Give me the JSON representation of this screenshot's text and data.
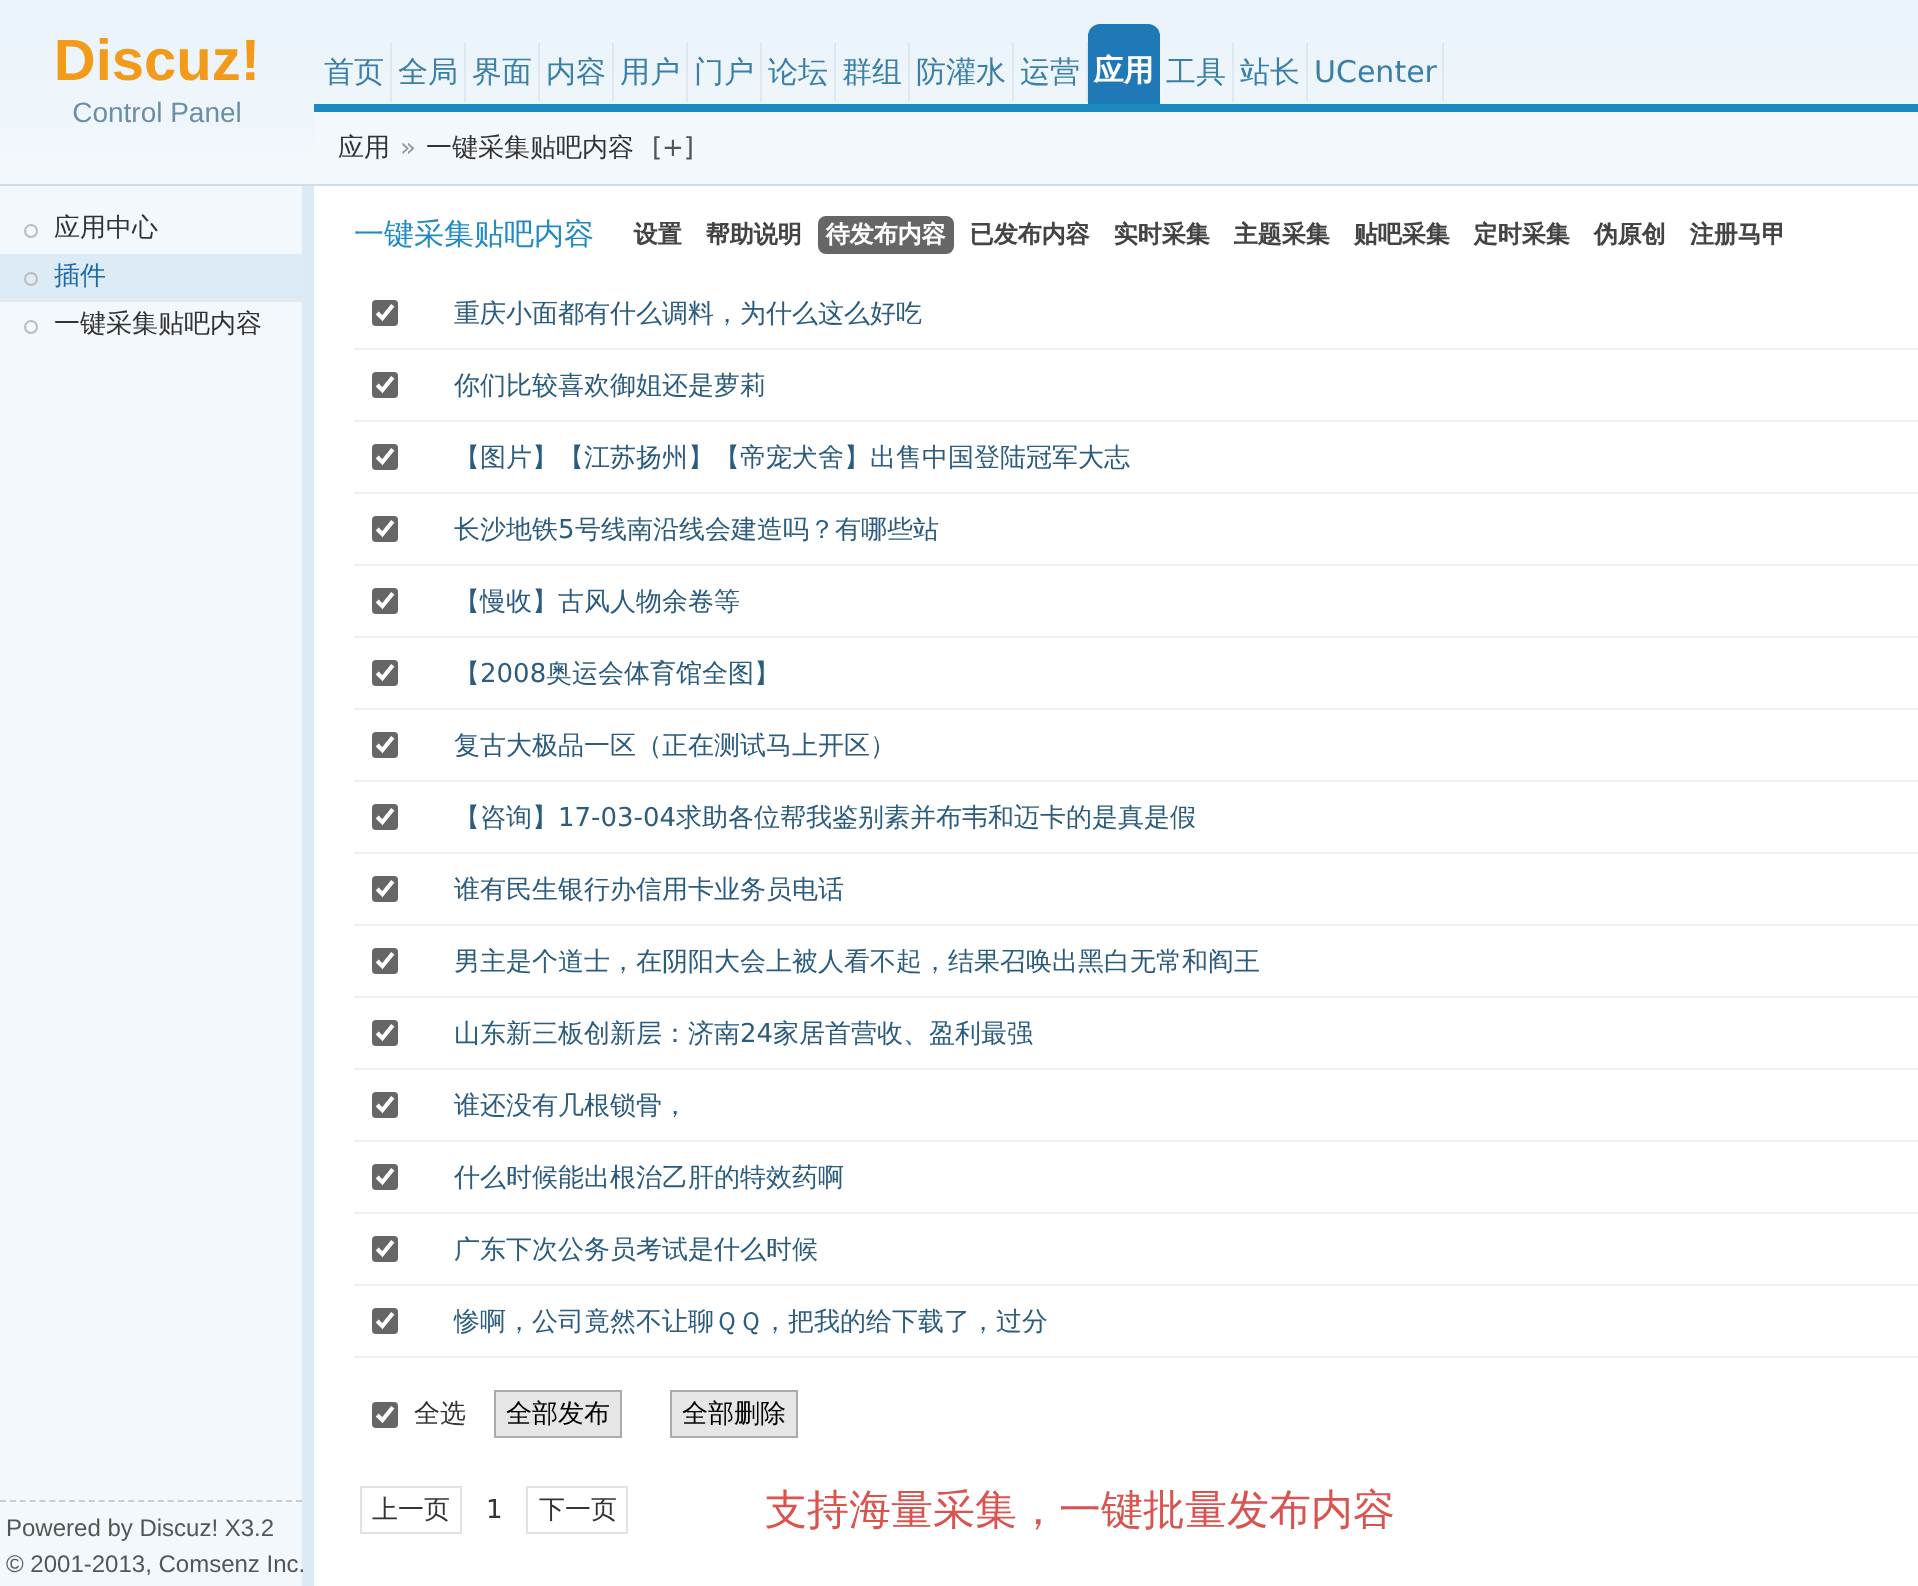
{
  "logo": {
    "brand": "Discuz!",
    "subtitle": "Control Panel"
  },
  "nav": [
    {
      "label": "首页",
      "selected": false
    },
    {
      "label": "全局",
      "selected": false
    },
    {
      "label": "界面",
      "selected": false
    },
    {
      "label": "内容",
      "selected": false
    },
    {
      "label": "用户",
      "selected": false
    },
    {
      "label": "门户",
      "selected": false
    },
    {
      "label": "论坛",
      "selected": false
    },
    {
      "label": "群组",
      "selected": false
    },
    {
      "label": "防灌水",
      "selected": false
    },
    {
      "label": "运营",
      "selected": false
    },
    {
      "label": "应用",
      "selected": true
    },
    {
      "label": "工具",
      "selected": false
    },
    {
      "label": "站长",
      "selected": false
    },
    {
      "label": "UCenter",
      "selected": false
    }
  ],
  "breadcrumb": {
    "root": "应用",
    "separator": "»",
    "current": "一键采集贴吧内容",
    "add": "[+]"
  },
  "sidebar": {
    "items": [
      {
        "label": "应用中心",
        "selected": false
      },
      {
        "label": "插件",
        "selected": true
      },
      {
        "label": "一键采集贴吧内容",
        "selected": false
      }
    ],
    "footer": [
      "Powered by Discuz! X3.2",
      "© 2001-2013, Comsenz Inc."
    ]
  },
  "page_title": "一键采集贴吧内容",
  "tabs": [
    {
      "label": "设置",
      "selected": false
    },
    {
      "label": "帮助说明",
      "selected": false
    },
    {
      "label": "待发布内容",
      "selected": true
    },
    {
      "label": "已发布内容",
      "selected": false
    },
    {
      "label": "实时采集",
      "selected": false
    },
    {
      "label": "主题采集",
      "selected": false
    },
    {
      "label": "贴吧采集",
      "selected": false
    },
    {
      "label": "定时采集",
      "selected": false
    },
    {
      "label": "伪原创",
      "selected": false
    },
    {
      "label": "注册马甲",
      "selected": false
    }
  ],
  "rows": [
    {
      "title": "重庆小面都有什么调料，为什么这么好吃",
      "checked": true
    },
    {
      "title": "你们比较喜欢御姐还是萝莉",
      "checked": true
    },
    {
      "title": "【图片】【江苏扬州】【帝宠犬舍】出售中国登陆冠军大志",
      "checked": true
    },
    {
      "title": "长沙地铁5号线南沿线会建造吗？有哪些站",
      "checked": true
    },
    {
      "title": "【慢收】古风人物余卷等",
      "checked": true
    },
    {
      "title": "【2008奥运会体育馆全图】",
      "checked": true
    },
    {
      "title": "复古大极品一区（正在测试马上开区）",
      "checked": true
    },
    {
      "title": "【咨询】17-03-04求助各位帮我鉴别素并布韦和迈卡的是真是假",
      "checked": true
    },
    {
      "title": "谁有民生银行办信用卡业务员电话",
      "checked": true
    },
    {
      "title": "男主是个道士，在阴阳大会上被人看不起，结果召唤出黑白无常和阎王",
      "checked": true
    },
    {
      "title": "山东新三板创新层：济南24家居首营收、盈利最强",
      "checked": true
    },
    {
      "title": "谁还没有几根锁骨，",
      "checked": true
    },
    {
      "title": "什么时候能出根治乙肝的特效药啊",
      "checked": true
    },
    {
      "title": "广东下次公务员考试是什么时候",
      "checked": true
    },
    {
      "title": "惨啊，公司竟然不让聊ＱＱ，把我的给下载了，过分",
      "checked": true
    }
  ],
  "select_all": {
    "label": "全选",
    "checked": true
  },
  "actions": [
    "全部发布",
    "全部删除"
  ],
  "pager": {
    "prev": "上一页",
    "page": "1",
    "next": "下一页"
  },
  "promo": "支持海量采集，一键批量发布内容"
}
